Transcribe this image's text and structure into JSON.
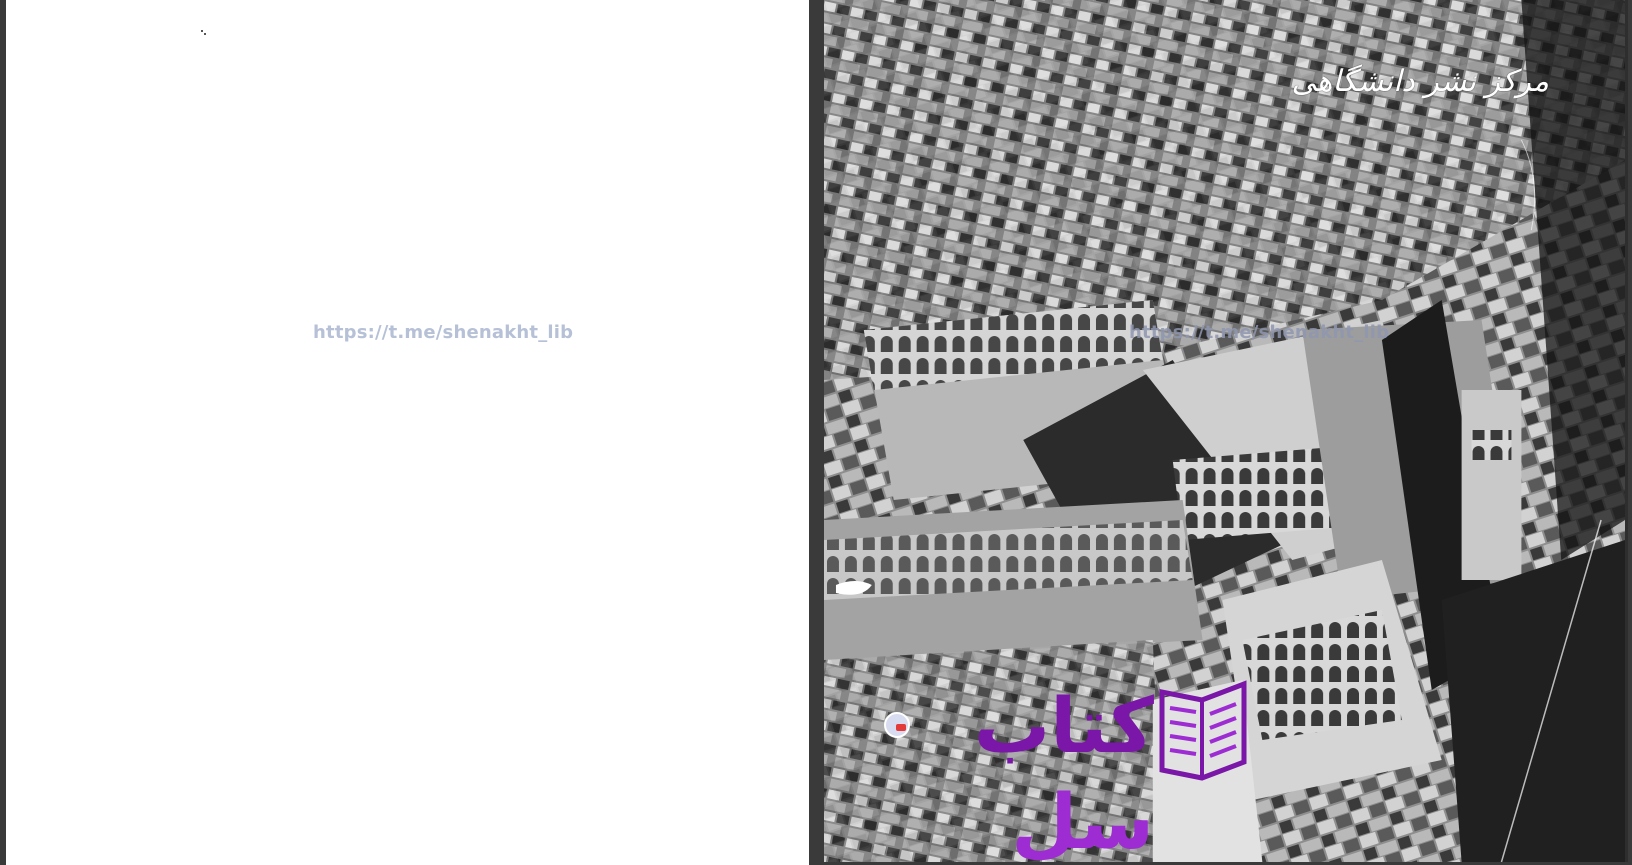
{
  "viewer": {
    "background_color": "#3a3a3a"
  },
  "left_page": {
    "watermark_url": "https://t.me/shenakht_lib",
    "background_color": "#ffffff"
  },
  "right_page": {
    "photo_description_icon": "aerial-city-photo",
    "watermark_url": "https://t.me/shenakht_lib",
    "publisher_mark": "مرکز نشر دانشگاهی",
    "logo": {
      "word_1": "کتاب",
      "word_2": "سل",
      "primary_color": "#7a16a8",
      "secondary_color": "#9d2cd2",
      "icon": "book-icon"
    }
  }
}
